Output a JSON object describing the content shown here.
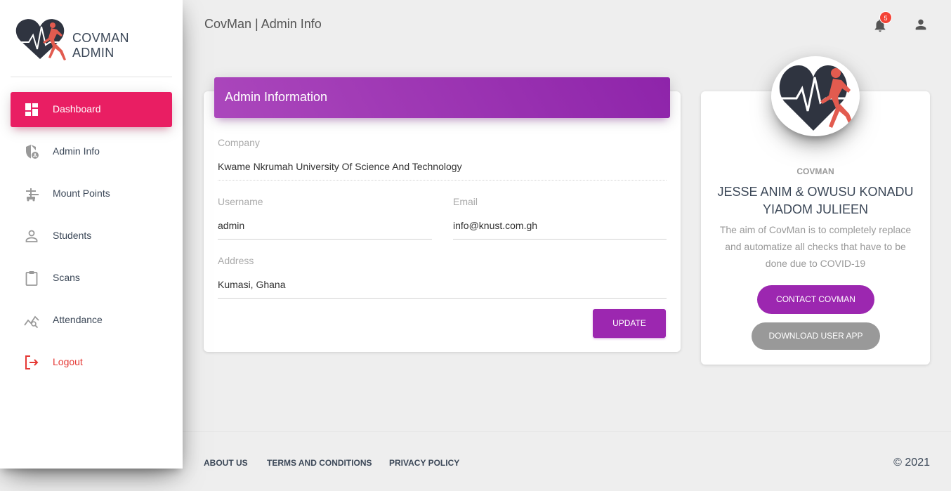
{
  "sidebar": {
    "brand": "COVMAN ADMIN",
    "items": [
      {
        "label": "Dashboard",
        "icon": "dashboard-icon"
      },
      {
        "label": "Admin Info",
        "icon": "admin-shield-icon"
      },
      {
        "label": "Mount Points",
        "icon": "mount-point-icon"
      },
      {
        "label": "Students",
        "icon": "person-icon"
      },
      {
        "label": "Scans",
        "icon": "clipboard-icon"
      },
      {
        "label": "Attendance",
        "icon": "attendance-chart-icon"
      },
      {
        "label": "Logout",
        "icon": "logout-icon"
      }
    ],
    "active_color": "#e91e63"
  },
  "topbar": {
    "title": "CovMan | Admin Info",
    "notification_count": "5"
  },
  "admin_card": {
    "title": "Admin Information",
    "company_label": "Company",
    "company_value": "Kwame Nkrumah University Of Science And Technology",
    "username_label": "Username",
    "username_value": "admin",
    "email_label": "Email",
    "email_value": "info@knust.com.gh",
    "address_label": "Address",
    "address_value": "Kumasi, Ghana",
    "update_label": "UPDATE",
    "accent": "#9c27b0"
  },
  "profile_card": {
    "category": "COVMAN",
    "name": "JESSE ANIM & OWUSU KONADU YIADOM JULIEEN",
    "description": "The aim of CovMan is to completely replace and automatize all checks that have to be done due to COVID-19",
    "contact_label": "CONTACT COVMAN",
    "download_label": "DOWNLOAD USER APP"
  },
  "footer": {
    "links": [
      "ABOUT US",
      "TERMS AND CONDITIONS",
      "PRIVACY POLICY"
    ],
    "copyright": "© 2021"
  }
}
